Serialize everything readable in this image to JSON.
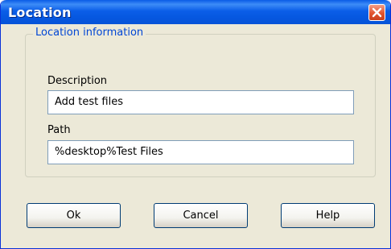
{
  "window": {
    "title": "Location"
  },
  "group": {
    "legend": "Location information",
    "description_label": "Description",
    "description_value": "Add test files",
    "path_label": "Path",
    "path_value": "%desktop%Test Files"
  },
  "buttons": {
    "ok": "Ok",
    "cancel": "Cancel",
    "help": "Help"
  },
  "icons": {
    "close": "close-icon"
  },
  "colors": {
    "titlebar": "#0058e6",
    "close": "#e2542e",
    "legend": "#0046d5",
    "dialog": "#ece9d8"
  }
}
